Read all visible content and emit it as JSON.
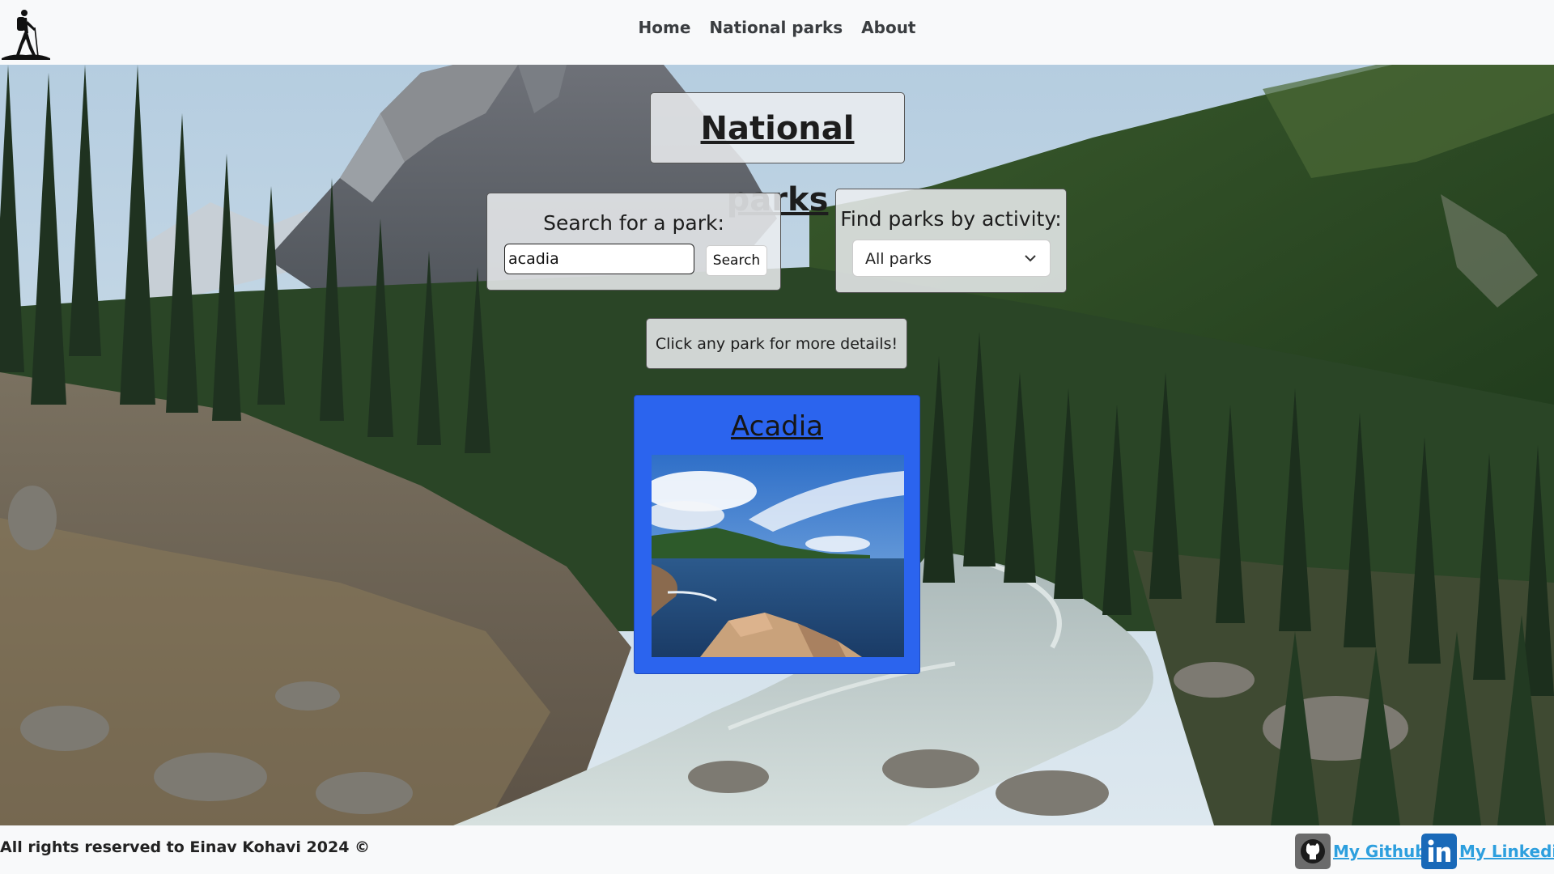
{
  "nav": {
    "logo_icon": "hiker-logo-icon",
    "links": [
      {
        "label": "Home"
      },
      {
        "label": "National parks"
      },
      {
        "label": "About"
      }
    ]
  },
  "main": {
    "title": "National parks",
    "search": {
      "label": "Search for a park:",
      "value": "acadia",
      "button_label": "Search"
    },
    "activity_filter": {
      "label": "Find parks by activity:",
      "selected": "All parks"
    },
    "hint": "Click any park for more details!",
    "parks": [
      {
        "name": "Acadia"
      }
    ]
  },
  "footer": {
    "copyright": "All rights reserved to Einav Kohavi 2024 ©",
    "github_label": "My Github",
    "github_icon": "github-icon",
    "linkedin_label": "My Linkedin",
    "linkedin_icon": "linkedin-icon"
  },
  "colors": {
    "card_background": "#2b64ee",
    "link_color": "#2d9fde",
    "navbar_background": "#f8f9fa"
  }
}
